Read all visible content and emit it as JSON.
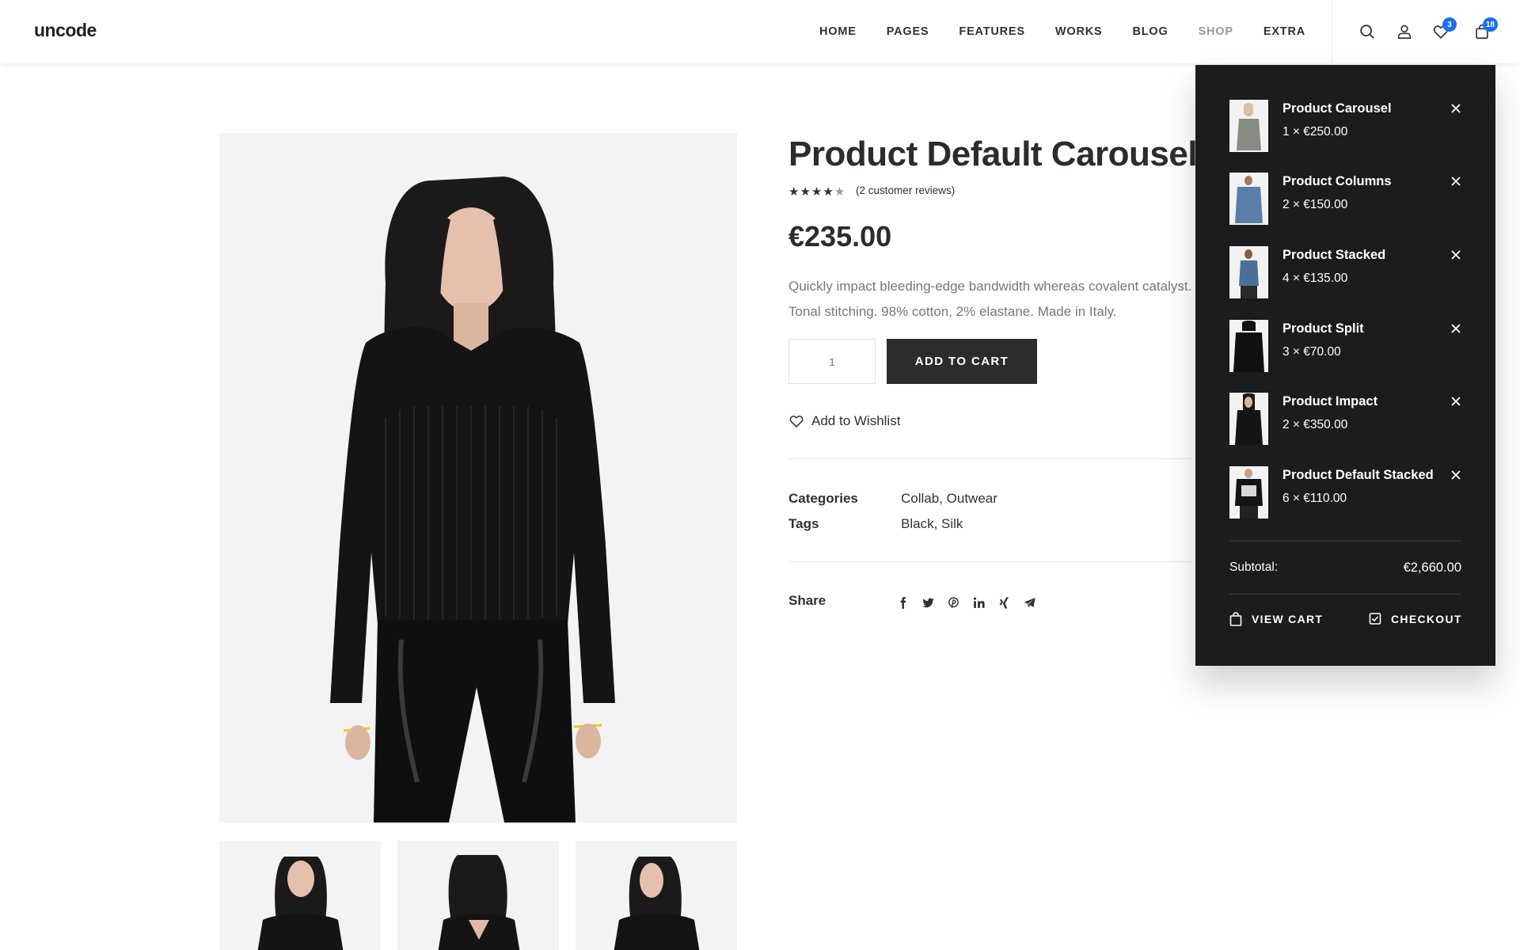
{
  "header": {
    "logo": "uncode",
    "nav": [
      "HOME",
      "PAGES",
      "FEATURES",
      "WORKS",
      "BLOG",
      "SHOP",
      "EXTRA"
    ],
    "active_nav": "SHOP",
    "wishlist_count": "3",
    "cart_count": "18",
    "icons": [
      "search-icon",
      "user-icon",
      "heart-icon",
      "bag-icon"
    ]
  },
  "product": {
    "title": "Product Default Carousel",
    "rating": 4.5,
    "rating_max": 5,
    "reviews": "(2 customer reviews)",
    "price": "€235.00",
    "description": "Quickly impact bleeding-edge bandwidth whereas covalent catalyst. Tonal stitching. 98% cotton, 2% elastane. Made in Italy.",
    "quantity": "1",
    "add_to_cart": "ADD TO CART",
    "wishlist": "Add to Wishlist",
    "categories_label": "Categories",
    "categories_value": "Collab, Outwear",
    "tags_label": "Tags",
    "tags_value": "Black, Silk",
    "share_label": "Share",
    "share_icons": [
      "facebook-icon",
      "twitter-icon",
      "pinterest-icon",
      "linkedin-icon",
      "xing-icon",
      "telegram-icon"
    ]
  },
  "cart": {
    "items": [
      {
        "name": "Product Carousel",
        "qty": "1 × €250.00"
      },
      {
        "name": "Product Columns",
        "qty": "2 × €150.00"
      },
      {
        "name": "Product Stacked",
        "qty": "4 × €135.00"
      },
      {
        "name": "Product Split",
        "qty": "3 × €70.00"
      },
      {
        "name": "Product Impact",
        "qty": "2 × €350.00"
      },
      {
        "name": "Product Default Stacked",
        "qty": "6 × €110.00"
      }
    ],
    "subtotal_label": "Subtotal:",
    "subtotal_value": "€2,660.00",
    "view_cart": "VIEW CART",
    "checkout": "CHECKOUT"
  },
  "colors": {
    "accent": "#1a6ff0",
    "dark": "#1b1c1e",
    "text": "#303133"
  }
}
